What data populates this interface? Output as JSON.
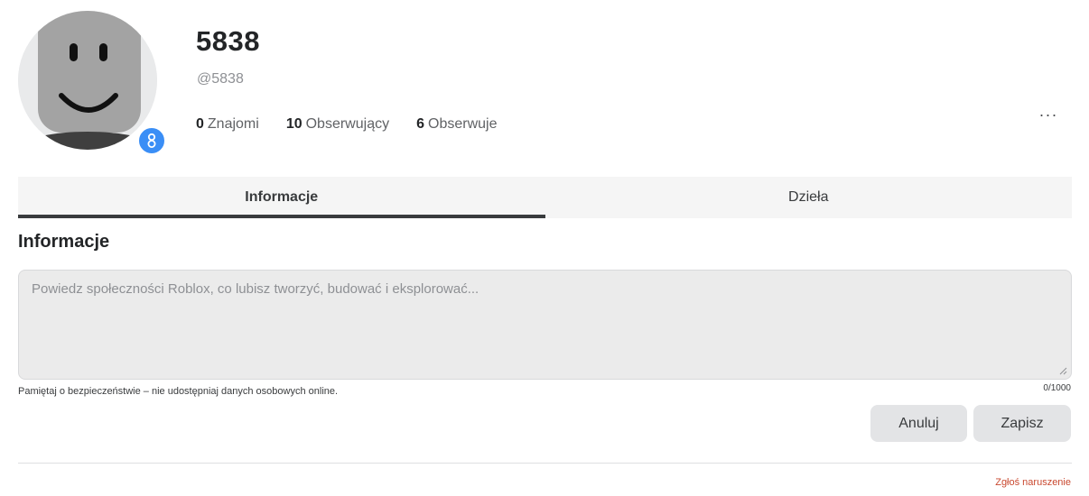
{
  "profile": {
    "display_name": "5838",
    "username": "@5838",
    "stats": [
      {
        "count": "0",
        "label": "Znajomi"
      },
      {
        "count": "10",
        "label": "Obserwujący"
      },
      {
        "count": "6",
        "label": "Obserwuje"
      }
    ],
    "more_icon": "···"
  },
  "tabs": [
    {
      "label": "Informacje",
      "active": true
    },
    {
      "label": "Dzieła",
      "active": false
    }
  ],
  "about": {
    "title": "Informacje",
    "placeholder": "Powiedz społeczności Roblox, co lubisz tworzyć, budować i eksplorować...",
    "value": "",
    "safety_note": "Pamiętaj o bezpieczeństwie – nie udostępniaj danych osobowych online.",
    "char_count": "0/1000",
    "cancel_label": "Anuluj",
    "save_label": "Zapisz"
  },
  "footer": {
    "report_label": "Zgłoś naruszenie"
  },
  "colors": {
    "badge": "#3a8ef6",
    "report": "#c9482f",
    "tab_indicator": "#393b3d"
  }
}
